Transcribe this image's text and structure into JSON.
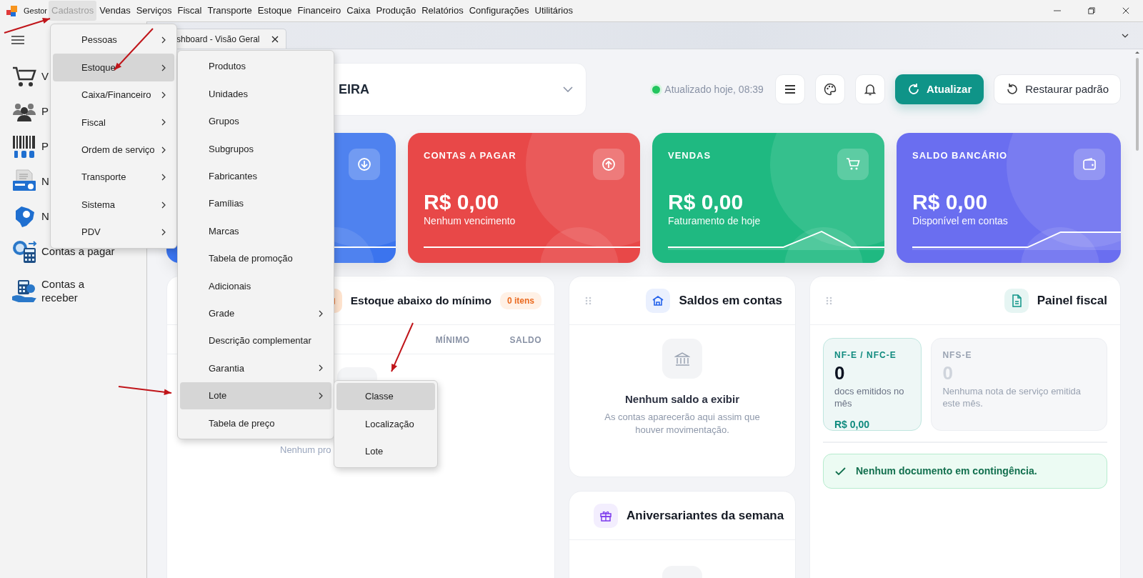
{
  "app": {
    "name": "Gestor"
  },
  "menubar": [
    {
      "label": "Cadastros",
      "selected": true
    },
    {
      "label": "Vendas",
      "selected": false
    },
    {
      "label": "Serviços",
      "selected": false
    },
    {
      "label": "Fiscal",
      "selected": false
    },
    {
      "label": "Transporte",
      "selected": false
    },
    {
      "label": "Estoque",
      "selected": false
    },
    {
      "label": "Financeiro",
      "selected": false
    },
    {
      "label": "Caixa",
      "selected": false
    },
    {
      "label": "Produção",
      "selected": false
    },
    {
      "label": "Relatórios",
      "selected": false
    },
    {
      "label": "Configurações",
      "selected": false
    },
    {
      "label": "Utilitários",
      "selected": false
    }
  ],
  "sidebar": {
    "items": [
      {
        "label": "V",
        "kind": "cart"
      },
      {
        "label": "P",
        "kind": "people"
      },
      {
        "label": "P",
        "kind": "barcode"
      },
      {
        "label": "N",
        "kind": "nfse"
      },
      {
        "label": "N",
        "kind": "nfe"
      },
      {
        "label": "Contas a pagar",
        "kind": "payable"
      },
      {
        "label": "Contas a receber",
        "kind": "receivable"
      }
    ]
  },
  "tabs": [
    {
      "label": "shboard - Visão Geral",
      "selected": true
    }
  ],
  "company_select": {
    "value": "EIRA"
  },
  "status": {
    "text": "Atualizado hoje, 08:39",
    "online": true
  },
  "toolbar": [
    {
      "kind": "menu"
    },
    {
      "kind": "palette"
    },
    {
      "kind": "bell"
    },
    {
      "kind": "primary",
      "label": "Atualizar"
    },
    {
      "kind": "secondary",
      "label": "Restaurar padrão"
    }
  ],
  "stat_cards": [
    {
      "color": "#3b74ee"
    },
    {
      "title": "CONTAS A PAGAR",
      "value": "R$ 0,00",
      "caption": "Nenhum vencimento",
      "color": "#e84848"
    },
    {
      "title": "VENDAS",
      "value": "R$ 0,00",
      "caption": "Faturamento de hoje",
      "color": "#1fb981"
    },
    {
      "title": "SALDO BANCÁRIO",
      "value": "R$ 0,00",
      "caption": "Disponível em contas",
      "color": "#6a6ef0"
    }
  ],
  "stock_panel": {
    "title": "Estoque abaixo do mínimo",
    "badge": "0 itens",
    "columns": [
      "MÍNIMO",
      "SALDO"
    ],
    "empty_text": "Nenhum pro"
  },
  "balances_panel": {
    "title": "Saldos em contas",
    "empty_title": "Nenhum saldo a exibir",
    "empty_text": "As contas aparecerão aqui assim que houver movimentação."
  },
  "birthdays_panel": {
    "title": "Aniversariantes da semana"
  },
  "fiscal_panel": {
    "title": "Painel fiscal",
    "cards": [
      {
        "label": "NF-E / NFC-E",
        "count": "0",
        "caption": "docs emitidos no mês",
        "amount": "R$ 0,00",
        "active": true
      },
      {
        "label": "NFS-E",
        "count": "0",
        "caption": "Nenhuma nota de serviço emitida este mês.",
        "active": false
      }
    ],
    "alert": "Nenhum documento em contingência."
  },
  "menus": [
    {
      "items": [
        {
          "label": "Pessoas",
          "submenu": true,
          "selected": false
        },
        {
          "label": "Estoque",
          "submenu": true,
          "selected": true
        },
        {
          "label": "Caixa/Financeiro",
          "submenu": true,
          "selected": false
        },
        {
          "label": "Fiscal",
          "submenu": true,
          "selected": false
        },
        {
          "label": "Ordem de serviço",
          "submenu": true,
          "selected": false
        },
        {
          "label": "Transporte",
          "submenu": true,
          "selected": false
        },
        {
          "label": "Sistema",
          "submenu": true,
          "selected": false
        },
        {
          "label": "PDV",
          "submenu": true,
          "selected": false
        }
      ]
    },
    {
      "items": [
        {
          "label": "Produtos",
          "submenu": false,
          "selected": false
        },
        {
          "label": "Unidades",
          "submenu": false,
          "selected": false
        },
        {
          "label": "Grupos",
          "submenu": false,
          "selected": false
        },
        {
          "label": "Subgrupos",
          "submenu": false,
          "selected": false
        },
        {
          "label": "Fabricantes",
          "submenu": false,
          "selected": false
        },
        {
          "label": "Famílias",
          "submenu": false,
          "selected": false
        },
        {
          "label": "Marcas",
          "submenu": false,
          "selected": false
        },
        {
          "label": "Tabela de promoção",
          "submenu": false,
          "selected": false
        },
        {
          "label": "Adicionais",
          "submenu": false,
          "selected": false
        },
        {
          "label": "Grade",
          "submenu": true,
          "selected": false
        },
        {
          "label": "Descrição complementar",
          "submenu": false,
          "selected": false
        },
        {
          "label": "Garantia",
          "submenu": true,
          "selected": false
        },
        {
          "label": "Lote",
          "submenu": true,
          "selected": true
        },
        {
          "label": "Tabela de preço",
          "submenu": false,
          "selected": false
        }
      ]
    },
    {
      "items": [
        {
          "label": "Classe",
          "submenu": false,
          "selected": true
        },
        {
          "label": "Localização",
          "submenu": false,
          "selected": false
        },
        {
          "label": "Lote",
          "submenu": false,
          "selected": false
        }
      ]
    }
  ]
}
